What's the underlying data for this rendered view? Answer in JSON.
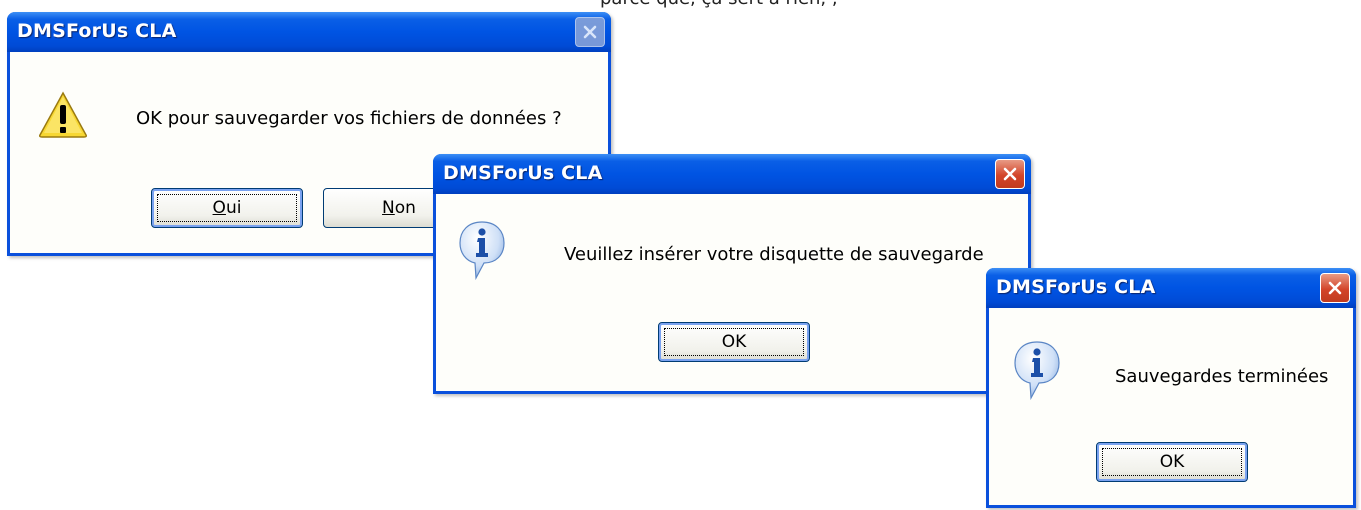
{
  "top_text_fragment": "parce que, ça sert à rien, ; ",
  "dialogs": [
    {
      "title": "DMSForUs CLA",
      "icon": "warning-icon",
      "message": "OK pour sauvegarder vos fichiers de données ?",
      "buttons": [
        {
          "label_u": "O",
          "label_rest": "ui"
        },
        {
          "label_u": "N",
          "label_rest": "on"
        }
      ],
      "close_state": "disabled"
    },
    {
      "title": "DMSForUs CLA",
      "icon": "info-icon",
      "message": "Veuillez insérer votre disquette de sauvegarde",
      "buttons": [
        {
          "label": "OK"
        }
      ],
      "close_state": "active"
    },
    {
      "title": "DMSForUs CLA",
      "icon": "info-icon",
      "message": "Sauvegardes terminées",
      "buttons": [
        {
          "label": "OK"
        }
      ],
      "close_state": "active"
    }
  ],
  "colors": {
    "title_bar": "#0054e3",
    "frame": "#0a50dc",
    "body": "#fefefa",
    "close_red": "#d3452a"
  }
}
